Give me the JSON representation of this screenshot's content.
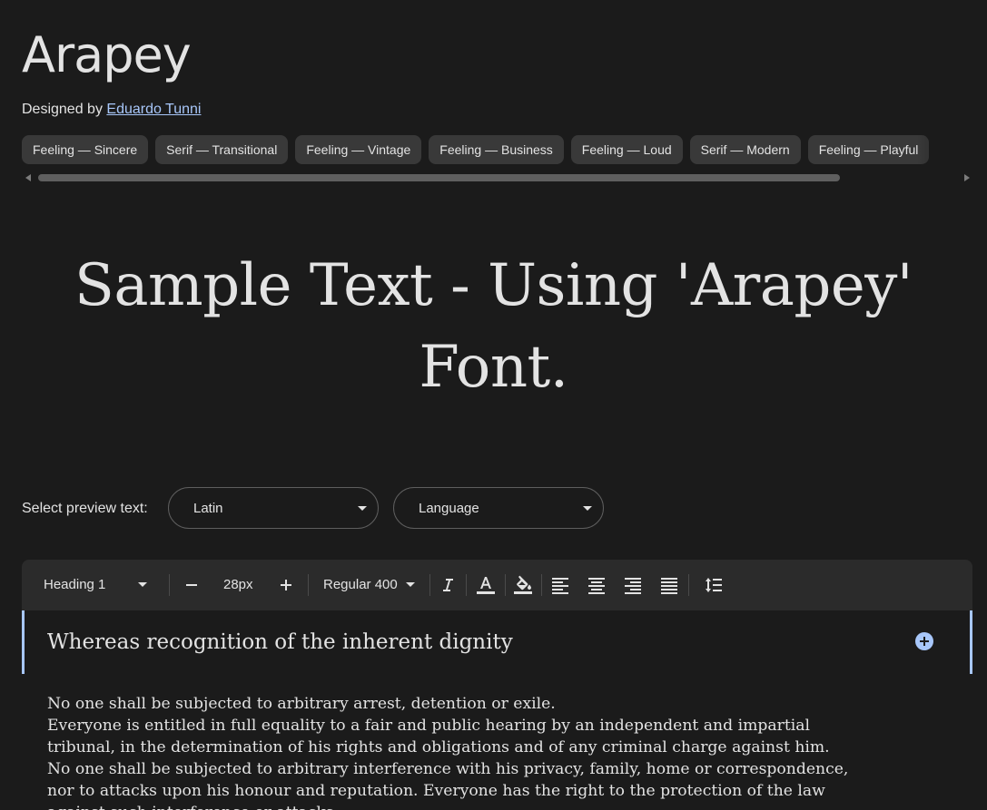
{
  "font": {
    "name": "Arapey",
    "designed_by_prefix": "Designed by",
    "designer": "Eduardo Tunni"
  },
  "tags": [
    "Feeling — Sincere",
    "Serif — Transitional",
    "Feeling — Vintage",
    "Feeling — Business",
    "Feeling — Loud",
    "Serif — Modern",
    "Feeling — Playful"
  ],
  "hero": {
    "sample_text": "Sample Text - Using 'Arapey' Font."
  },
  "preview": {
    "label": "Select preview text:",
    "script_value": "Latin",
    "language_value": "Language"
  },
  "toolbar": {
    "style_value": "Heading 1",
    "decrease_icon": "minus-icon",
    "size_value": "28px",
    "increase_icon": "plus-icon",
    "weight_value": "Regular 400",
    "icons": [
      "italic-icon",
      "text-color-icon",
      "highlight-color-icon",
      "align-left-icon",
      "align-center-icon",
      "align-right-icon",
      "align-justify-icon",
      "line-spacing-icon"
    ]
  },
  "editor": {
    "heading_text": "Whereas recognition of the inherent dignity",
    "add_icon": "add-circle-icon",
    "body_lines": [
      "No one shall be subjected to arbitrary arrest, detention or exile.",
      "Everyone is entitled in full equality to a fair and public hearing by an independent and impartial",
      "tribunal, in the determination of his rights and obligations and of any criminal charge against him.",
      "No one shall be subjected to arbitrary interference with his privacy, family, home or correspondence,",
      "nor to attacks upon his honour and reputation. Everyone has the right to the protection of the law",
      "against such interference or attacks."
    ]
  },
  "colors": {
    "background": "#1b1b1b",
    "toolbar": "#2b2b2b",
    "chip": "#393939",
    "accent": "#a8c7fa",
    "text": "#e3e3e3"
  }
}
